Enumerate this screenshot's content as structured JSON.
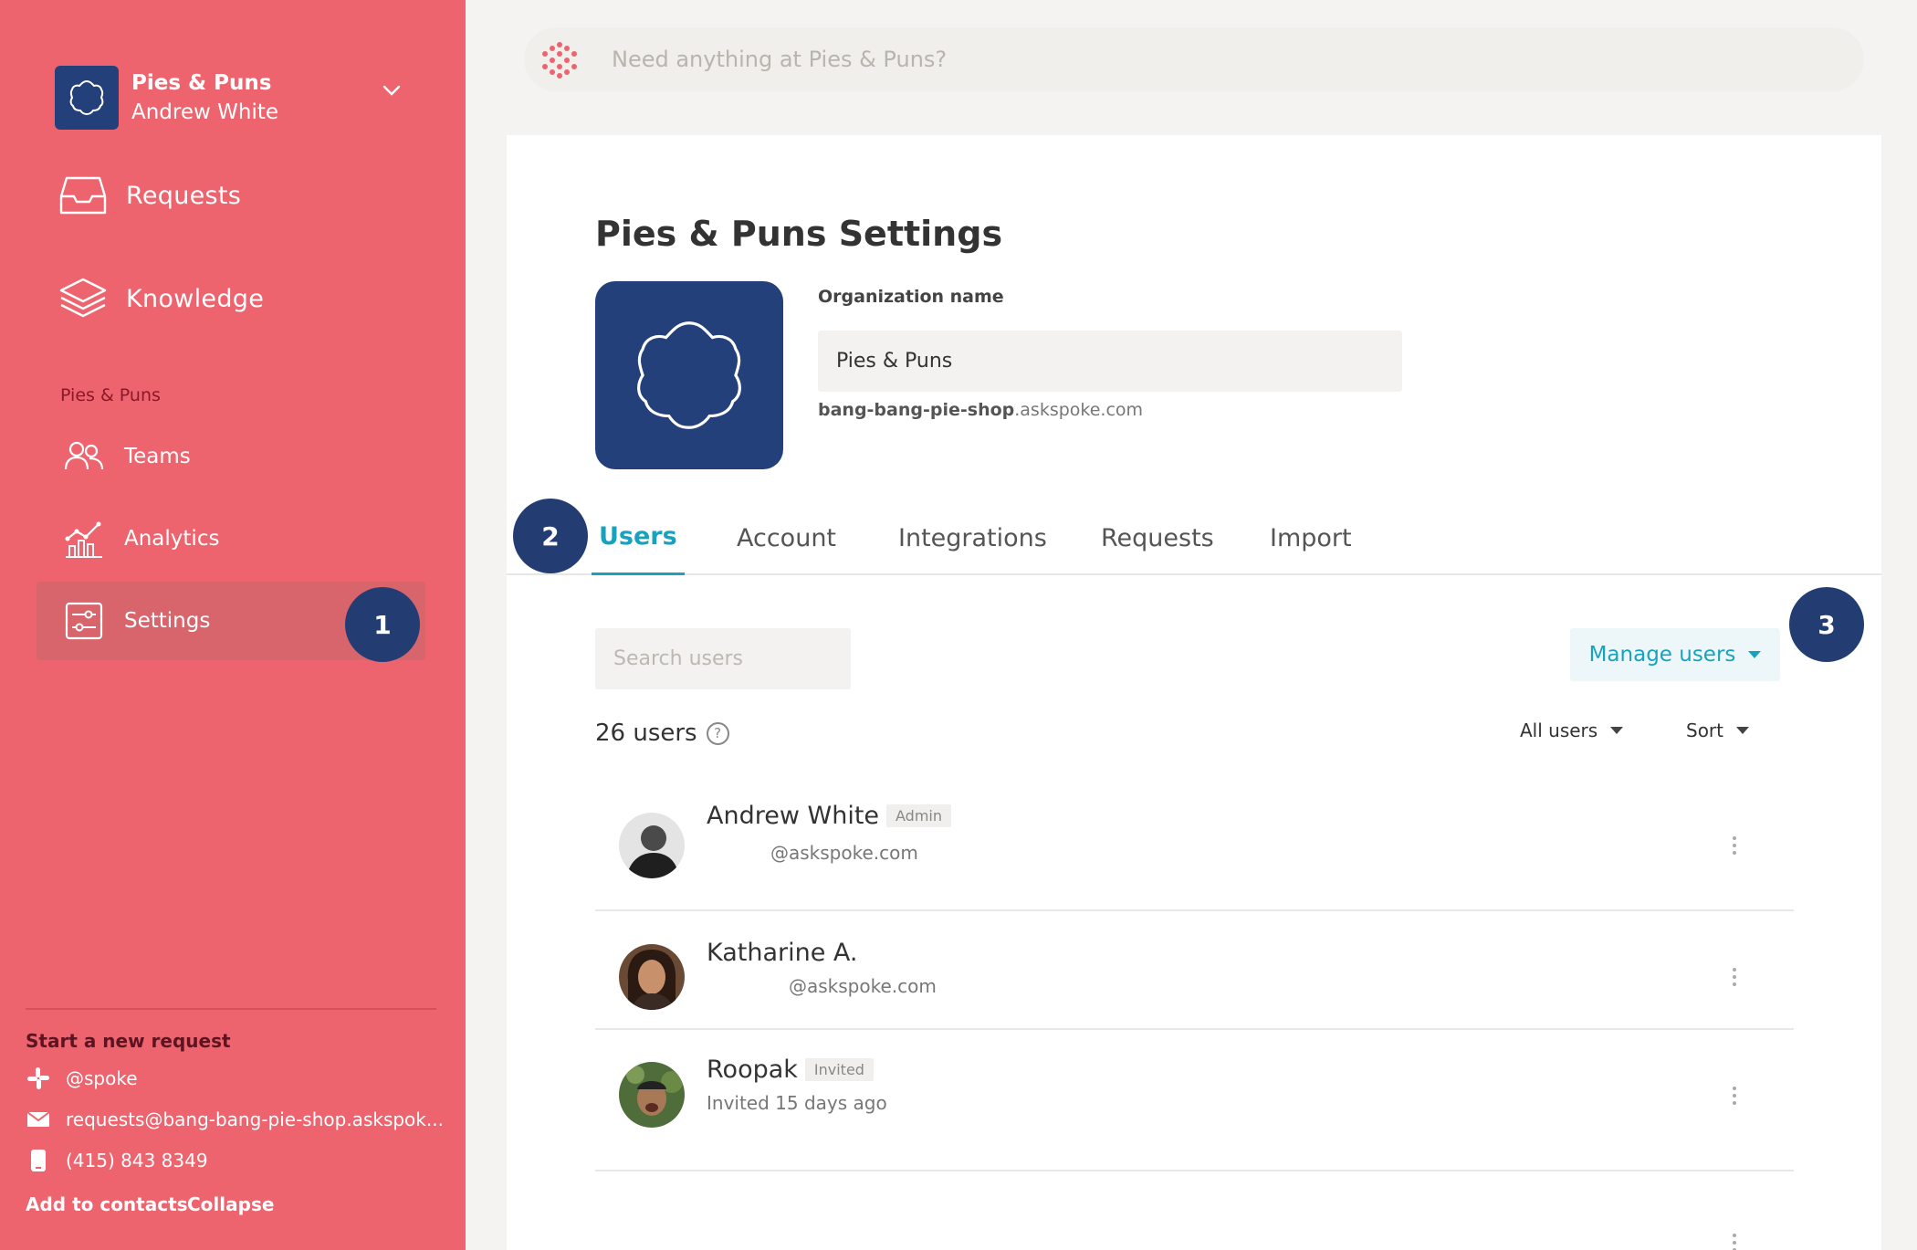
{
  "sidebar": {
    "org_name": "Pies & Puns",
    "user_name": "Andrew White",
    "nav_primary": [
      {
        "label": "Requests"
      },
      {
        "label": "Knowledge"
      }
    ],
    "section_label": "Pies & Puns",
    "nav_secondary": [
      {
        "label": "Teams"
      },
      {
        "label": "Analytics"
      },
      {
        "label": "Settings",
        "active": true
      }
    ],
    "start_request_label": "Start a new request",
    "contacts": [
      {
        "icon": "slack-icon",
        "text": "@spoke"
      },
      {
        "icon": "mail-icon",
        "text": "requests@bang-bang-pie-shop.askspok..."
      },
      {
        "icon": "phone-icon",
        "text": "(415) 843 8349"
      }
    ],
    "add_to_contacts": "Add to contacts",
    "collapse": "Collapse"
  },
  "search": {
    "placeholder": "Need anything at Pies & Puns?"
  },
  "page": {
    "title_org": "Pies & Puns",
    "title_suffix": "Settings",
    "org_field_label": "Organization name",
    "org_field_value": "Pies & Puns",
    "subdomain_bold": "bang-bang-pie-shop",
    "subdomain_rest": ".askspoke.com"
  },
  "tabs": [
    {
      "label": "Users",
      "active": true
    },
    {
      "label": "Account"
    },
    {
      "label": "Integrations"
    },
    {
      "label": "Requests"
    },
    {
      "label": "Import"
    }
  ],
  "users_panel": {
    "search_placeholder": "Search users",
    "manage_label": "Manage users",
    "count_label": "26 users",
    "help_glyph": "?",
    "filter_label": "All users",
    "sort_label": "Sort"
  },
  "users": [
    {
      "name": "Andrew White",
      "badge": "Admin",
      "sub": "@askspoke.com"
    },
    {
      "name": "Katharine A.",
      "badge": "",
      "sub": "@askspoke.com"
    },
    {
      "name": "Roopak",
      "badge": "Invited",
      "sub": "Invited 15 days ago"
    }
  ],
  "callouts": [
    "1",
    "2",
    "3"
  ],
  "colors": {
    "sidebar": "#ee646e",
    "brand_blue": "#24407a",
    "accent_teal": "#17a3bd",
    "callout": "#233d73"
  }
}
